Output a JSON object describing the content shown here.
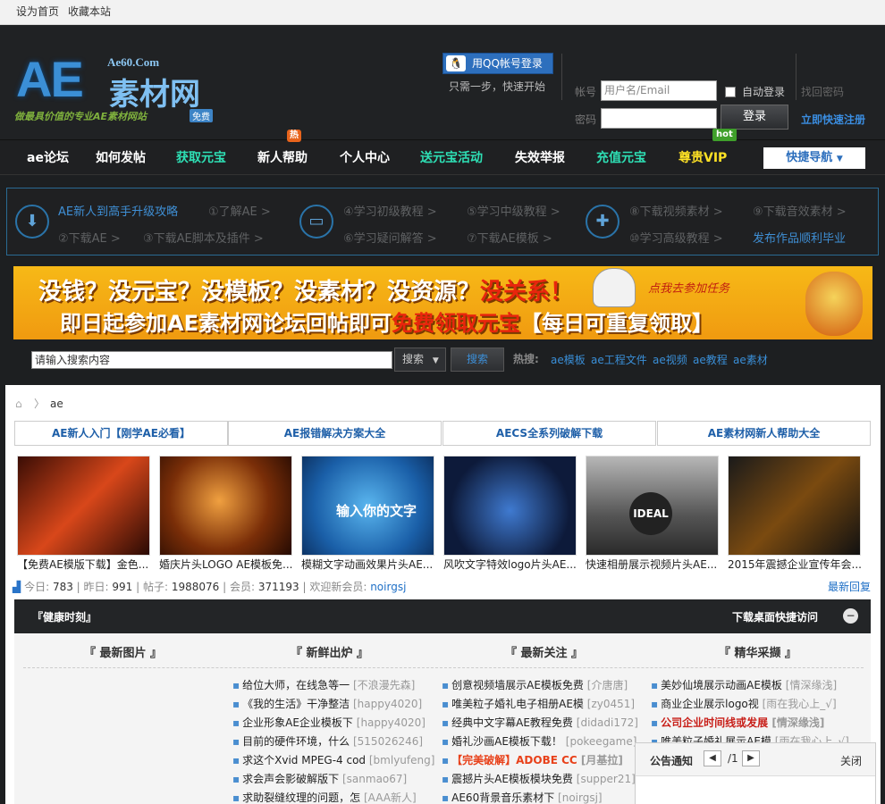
{
  "topbar": {
    "set_home": "设为首页",
    "bookmark": "收藏本站"
  },
  "logo": {
    "ae": "AE",
    "domain": "Ae60.Com",
    "cn": "素材网",
    "slogan": "做最具价值的专业AE素材网站",
    "badge": "免费"
  },
  "login": {
    "qq_button": "用QQ帐号登录",
    "qq_hint": "只需一步，快速开始",
    "account_label": "帐号",
    "account_placeholder": "用户名/Email",
    "password_label": "密码",
    "auto_login": "自动登录",
    "login_button": "登录",
    "forgot": "找回密码",
    "register": "立即快速注册"
  },
  "nav": {
    "items": [
      "ae论坛",
      "如何发帖",
      "获取元宝",
      "新人帮助",
      "个人中心",
      "送元宝活动",
      "失效举报",
      "充值元宝",
      "尊贵VIP"
    ],
    "new_help_badge": "热",
    "vip_badge": "hot",
    "quick_nav": "快捷导航"
  },
  "guide": {
    "title": "AE新人到高手升级攻略",
    "links": [
      "①了解AE >",
      "②下载AE >",
      "③下载AE脚本及插件 >",
      "④学习初级教程 >",
      "⑤学习中级教程 >",
      "⑥学习疑问解答 >",
      "⑦下载AE模板 >",
      "⑧下载视频素材 >",
      "⑨下载音效素材 >",
      "⑩学习高级教程 >"
    ],
    "final": "发布作品顺利毕业"
  },
  "banner": {
    "line1": "没钱？没元宝？没模板？没素材？没资源？",
    "line1_red": "没关系！",
    "line2_a": "即日起参加AE素材网论坛回帖即可",
    "line2_red": "免费领取元宝",
    "line2_b": "【每日可重复领取】",
    "side": "点我去参加任务"
  },
  "search": {
    "placeholder": "请输入搜索内容",
    "scope": "搜索",
    "button": "搜索",
    "hot_label": "热搜:",
    "keywords": [
      "ae模板",
      "ae工程文件",
      "ae视频",
      "ae教程",
      "ae素材"
    ]
  },
  "breadcrumb": {
    "current": "ae"
  },
  "tabs": [
    "AE新人入门【刚学AE必看】",
    "AE报错解决方案大全",
    "AECS全系列破解下载",
    "AE素材网新人帮助大全"
  ],
  "thumbs": [
    {
      "caption": "【免费AE模版下载】金色..."
    },
    {
      "caption": "婚庆片头LOGO AE模板免..."
    },
    {
      "caption": "模糊文字动画效果片头AE...",
      "text": "输入你的文字"
    },
    {
      "caption": "风吹文字特效logo片头AE..."
    },
    {
      "caption": "快速相册展示视频片头AE...",
      "text": "IDEAL"
    },
    {
      "caption": "2015年震撼企业宣传年会..."
    }
  ],
  "stats": {
    "today_label": "今日:",
    "today": "783",
    "yesterday_label": "昨日:",
    "yesterday": "991",
    "posts_label": "帖子:",
    "posts": "1988076",
    "members_label": "会员:",
    "members": "371193",
    "newest_label": "欢迎新会员:",
    "newest": "noirgsj",
    "latest_reply": "最新回复"
  },
  "health_bar": {
    "title": "『健康时刻』",
    "download": "下载桌面快捷访问",
    "close": "−"
  },
  "columns": {
    "headers": [
      "『  最新图片  』",
      "『  新鲜出炉  』",
      "『  最新关注  』",
      "『  精华采撷  』"
    ],
    "fresh": [
      {
        "t": "给位大师，在线急等一",
        "a": "[不浪漫先森]"
      },
      {
        "t": "《我的生活》干净整洁",
        "a": "[happy4020]"
      },
      {
        "t": "企业形象AE企业模板下",
        "a": "[happy4020]"
      },
      {
        "t": "目前的硬件环境，什么",
        "a": "[515026246]"
      },
      {
        "t": "求这个Xvid MPEG-4 cod",
        "a": "[bmlyufeng]"
      },
      {
        "t": "求会声会影破解版下",
        "a": "[sanmao67]"
      },
      {
        "t": "求助裂缝纹理的问题，怎",
        "a": "[AAA新人]"
      }
    ],
    "focus": [
      {
        "t": "创意视频墙展示AE模板免费",
        "a": "[介唐唐]"
      },
      {
        "t": "唯美粒子婚礼电子相册AE模",
        "a": "[zy0451]"
      },
      {
        "t": "经典中文字幕AE教程免费",
        "a": "[didadi172]"
      },
      {
        "t": "婚礼沙画AE模板下载！",
        "a": "[pokeegame]"
      },
      {
        "t": "【完美破解】ADOBE CC",
        "a": "[月基拉]"
      },
      {
        "t": "震撼片头AE模板模块免费",
        "a": "[supper21]"
      },
      {
        "t": "AE60背景音乐素材下",
        "a": "[noirgsj]"
      }
    ],
    "essence": [
      {
        "t": "美妙仙境展示动画AE模板",
        "a": "[情深缘浅]"
      },
      {
        "t": "商业企业展示logo视",
        "a": "[雨在我心上_√]"
      },
      {
        "t": "公司企业时间线或发展",
        "a": "[情深缘浅]"
      },
      {
        "t": "唯美粒子婚礼展示AE模",
        "a": "[雨在我心上_√]"
      }
    ]
  },
  "notice": {
    "title": "公告通知",
    "page": "/1",
    "close": "关闭",
    "prev": "◀",
    "next": "▶"
  }
}
